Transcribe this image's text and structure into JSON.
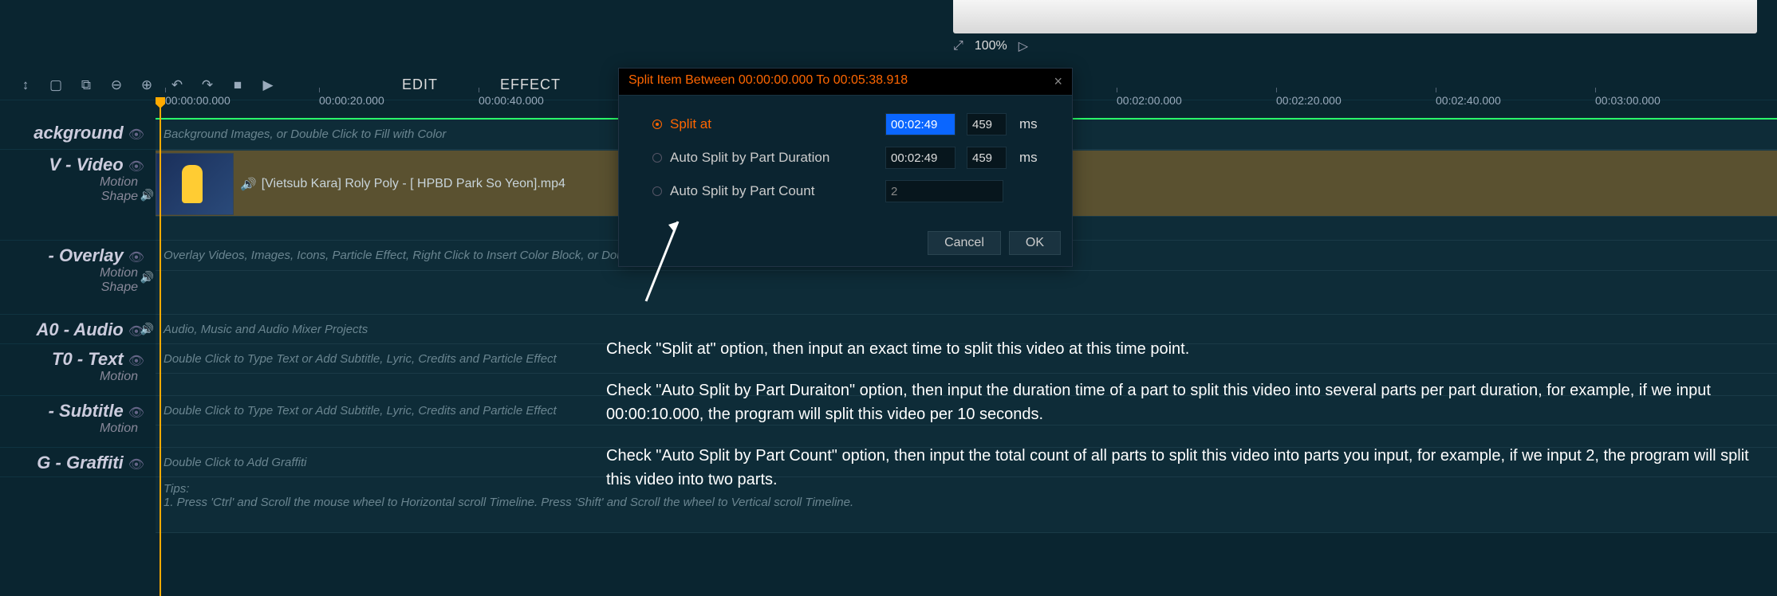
{
  "preview": {
    "zoom": "100%"
  },
  "toolbar": {
    "edit": "EDIT",
    "effect": "EFFECT"
  },
  "timeline": {
    "ticks": [
      "00:00:00.000",
      "00:00:20.000",
      "00:00:40.000",
      "00:02:00.000",
      "00:02:20.000",
      "00:02:40.000",
      "00:03:00.000"
    ]
  },
  "tracks": {
    "background": {
      "name": "ackground",
      "placeholder": "Background Images, or Double Click to Fill with Color"
    },
    "video": {
      "name": "V - Video",
      "sub1": "Motion",
      "sub2": "Shape",
      "clip_name": "[Vietsub Kara] Roly Poly - [ HPBD Park So Yeon].mp4"
    },
    "overlay": {
      "name": "- Overlay",
      "sub1": "Motion",
      "sub2": "Shape",
      "placeholder": "Overlay Videos, Images, Icons, Particle Effect, Right Click to Insert Color Block, or Double Click to Insert Audio Spectrum"
    },
    "audio": {
      "name": "A0 - Audio",
      "placeholder": "Audio, Music and Audio Mixer Projects"
    },
    "text": {
      "name": "T0 - Text",
      "sub1": "Motion",
      "placeholder": "Double Click to Type Text or Add Subtitle, Lyric, Credits and Particle Effect"
    },
    "subtitle": {
      "name": "- Subtitle",
      "sub1": "Motion",
      "placeholder": "Double Click to Type Text or Add Subtitle, Lyric, Credits and Particle Effect"
    },
    "graffiti": {
      "name": "G - Graffiti",
      "placeholder": "Double Click to Add Graffiti"
    },
    "tips": {
      "title": "Tips:",
      "line1": "1. Press 'Ctrl' and Scroll the mouse wheel to Horizontal scroll Timeline. Press 'Shift' and Scroll the wheel to Vertical scroll Timeline."
    }
  },
  "dialog": {
    "title": "Split Item Between 00:00:00.000 To 00:05:38.918",
    "split_at": "Split at",
    "split_at_time": "00:02:49",
    "split_at_ms": "459",
    "auto_duration": "Auto Split by Part Duration",
    "auto_duration_time": "00:02:49",
    "auto_duration_ms": "459",
    "auto_count": "Auto Split by Part Count",
    "auto_count_value": "2",
    "ms": "ms",
    "cancel": "Cancel",
    "ok": "OK"
  },
  "annotations": {
    "p1": "Check \"Split at\" option, then input an exact time to split this video at this time point.",
    "p2": "Check \"Auto Split by Part Duraiton\" option, then input the duration time of a part to split this video into several parts per part duration, for example, if we input 00:00:10.000, the program will split this video per 10 seconds.",
    "p3": "Check \"Auto Split by Part Count\" option, then input the total count of all parts to split this video into parts you input, for example, if we input 2, the program will split this video into two parts."
  }
}
